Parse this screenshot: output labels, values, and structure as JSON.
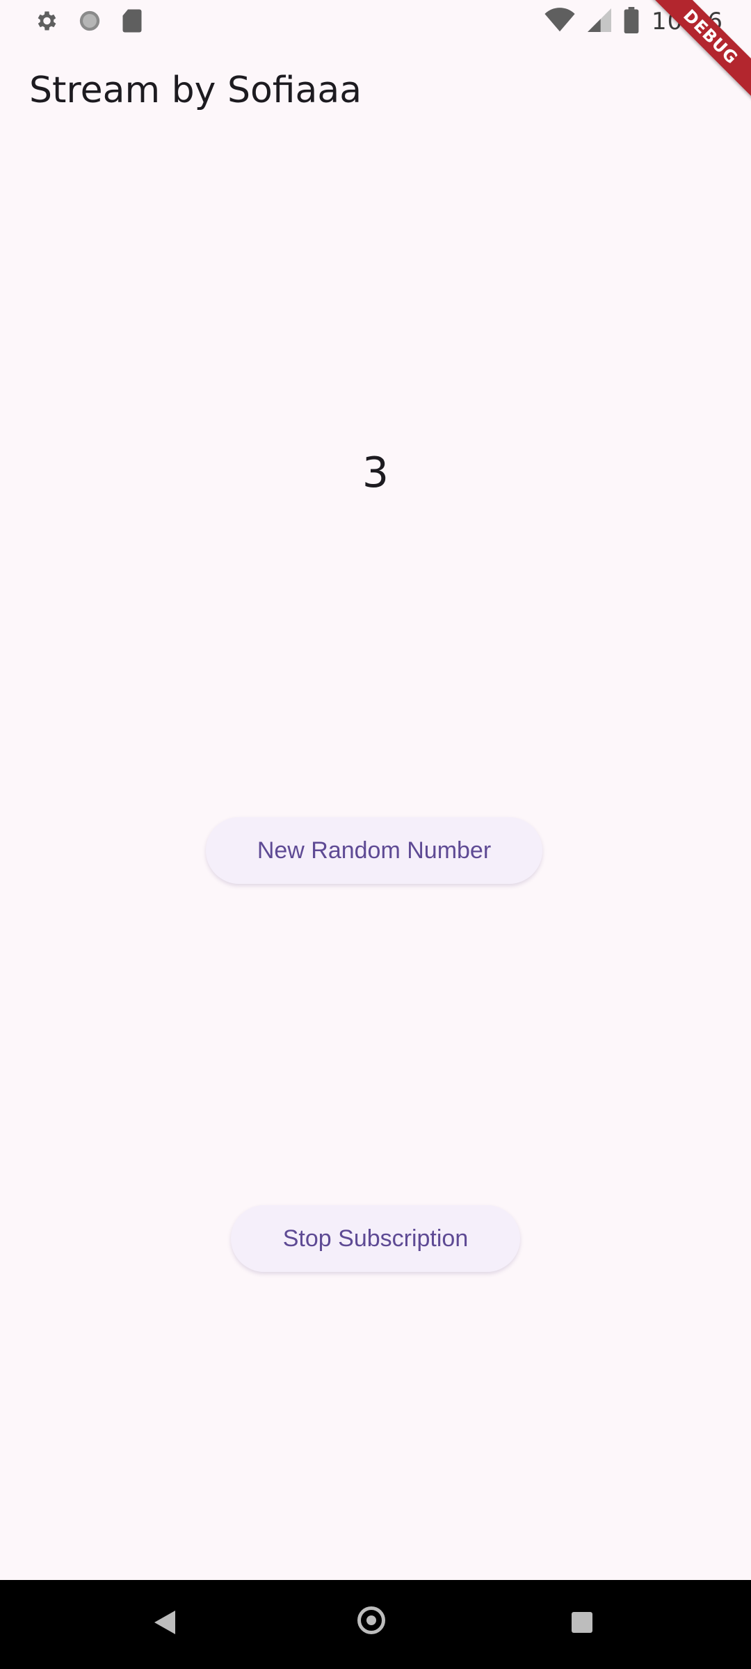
{
  "status_bar": {
    "time": "10:26",
    "left_icons": [
      "gear-icon",
      "circle-icon",
      "sd-card-icon"
    ],
    "right_icons": [
      "wifi-icon",
      "signal-icon",
      "battery-icon"
    ]
  },
  "debug_banner": {
    "label": "DEBUG"
  },
  "app_bar": {
    "title": "Stream by Sofiaaa"
  },
  "main": {
    "number": "3",
    "new_random_button_label": "New Random Number",
    "stop_subscription_button_label": "Stop Subscription"
  },
  "colors": {
    "background": "#fdf7fa",
    "button_background": "#f5effa",
    "button_text": "#5e4a94",
    "debug_ribbon": "#b3262e"
  },
  "nav_bar": {
    "icons": [
      "back-icon",
      "home-icon",
      "recents-icon"
    ]
  }
}
